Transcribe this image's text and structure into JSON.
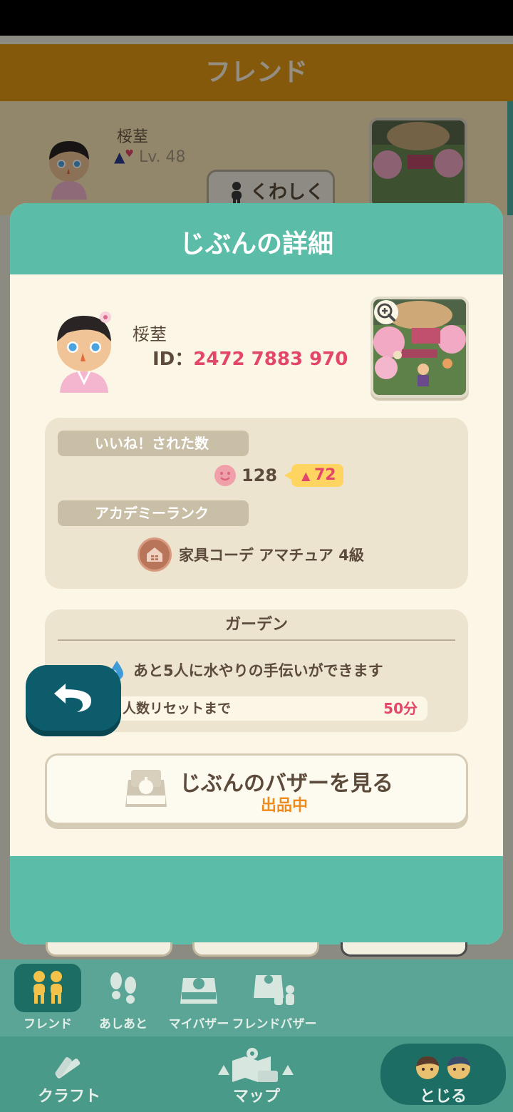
{
  "background": {
    "header_title": "フレンド",
    "friend_name": "桵荎",
    "friend_level": "Lv. 48",
    "detail_button": "くわしく"
  },
  "modal": {
    "title": "じぶんの詳細",
    "profile": {
      "name": "桵荎",
      "id_label": "ID：",
      "id_value": "2472 7883 970"
    },
    "likes": {
      "label": "いいね！された数",
      "count": "128",
      "delta": "72"
    },
    "academy": {
      "label": "アカデミーランク",
      "rank": "家具コーデ アマチュア 4級"
    },
    "garden": {
      "title": "ガーデン",
      "water_text": "あと5人に水やりの手伝いができます",
      "reset_label": "人数リセットまで",
      "reset_value": "50分"
    },
    "bazaar": {
      "label": "じぶんのバザーを見る",
      "status": "出品中"
    }
  },
  "subnav": [
    {
      "label": "フレンド",
      "icon": "friends-icon",
      "active": true
    },
    {
      "label": "あしあと",
      "icon": "footprints-icon",
      "active": false
    },
    {
      "label": "マイバザー",
      "icon": "my-bazaar-icon",
      "active": false
    },
    {
      "label": "フレンドバザー",
      "icon": "friend-bazaar-icon",
      "active": false
    }
  ],
  "mainnav": {
    "craft": "クラフト",
    "map": "マップ",
    "close": "とじる"
  },
  "colors": {
    "accent_teal": "#5bbca8",
    "highlight_pink": "#e2466a",
    "orange_status": "#ef8a1c",
    "header_orange": "#e39a14"
  }
}
